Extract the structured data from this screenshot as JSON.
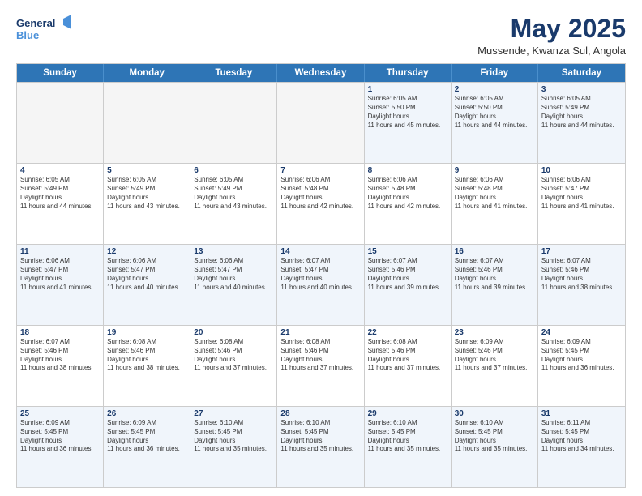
{
  "logo": {
    "line1": "General",
    "line2": "Blue"
  },
  "title": "May 2025",
  "location": "Mussende, Kwanza Sul, Angola",
  "days": [
    "Sunday",
    "Monday",
    "Tuesday",
    "Wednesday",
    "Thursday",
    "Friday",
    "Saturday"
  ],
  "rows": [
    [
      {
        "date": "",
        "sunrise": "",
        "sunset": "",
        "daylight": ""
      },
      {
        "date": "",
        "sunrise": "",
        "sunset": "",
        "daylight": ""
      },
      {
        "date": "",
        "sunrise": "",
        "sunset": "",
        "daylight": ""
      },
      {
        "date": "",
        "sunrise": "",
        "sunset": "",
        "daylight": ""
      },
      {
        "date": "1",
        "sunrise": "6:05 AM",
        "sunset": "5:50 PM",
        "daylight": "11 hours and 45 minutes."
      },
      {
        "date": "2",
        "sunrise": "6:05 AM",
        "sunset": "5:50 PM",
        "daylight": "11 hours and 44 minutes."
      },
      {
        "date": "3",
        "sunrise": "6:05 AM",
        "sunset": "5:49 PM",
        "daylight": "11 hours and 44 minutes."
      }
    ],
    [
      {
        "date": "4",
        "sunrise": "6:05 AM",
        "sunset": "5:49 PM",
        "daylight": "11 hours and 44 minutes."
      },
      {
        "date": "5",
        "sunrise": "6:05 AM",
        "sunset": "5:49 PM",
        "daylight": "11 hours and 43 minutes."
      },
      {
        "date": "6",
        "sunrise": "6:05 AM",
        "sunset": "5:49 PM",
        "daylight": "11 hours and 43 minutes."
      },
      {
        "date": "7",
        "sunrise": "6:06 AM",
        "sunset": "5:48 PM",
        "daylight": "11 hours and 42 minutes."
      },
      {
        "date": "8",
        "sunrise": "6:06 AM",
        "sunset": "5:48 PM",
        "daylight": "11 hours and 42 minutes."
      },
      {
        "date": "9",
        "sunrise": "6:06 AM",
        "sunset": "5:48 PM",
        "daylight": "11 hours and 41 minutes."
      },
      {
        "date": "10",
        "sunrise": "6:06 AM",
        "sunset": "5:47 PM",
        "daylight": "11 hours and 41 minutes."
      }
    ],
    [
      {
        "date": "11",
        "sunrise": "6:06 AM",
        "sunset": "5:47 PM",
        "daylight": "11 hours and 41 minutes."
      },
      {
        "date": "12",
        "sunrise": "6:06 AM",
        "sunset": "5:47 PM",
        "daylight": "11 hours and 40 minutes."
      },
      {
        "date": "13",
        "sunrise": "6:06 AM",
        "sunset": "5:47 PM",
        "daylight": "11 hours and 40 minutes."
      },
      {
        "date": "14",
        "sunrise": "6:07 AM",
        "sunset": "5:47 PM",
        "daylight": "11 hours and 40 minutes."
      },
      {
        "date": "15",
        "sunrise": "6:07 AM",
        "sunset": "5:46 PM",
        "daylight": "11 hours and 39 minutes."
      },
      {
        "date": "16",
        "sunrise": "6:07 AM",
        "sunset": "5:46 PM",
        "daylight": "11 hours and 39 minutes."
      },
      {
        "date": "17",
        "sunrise": "6:07 AM",
        "sunset": "5:46 PM",
        "daylight": "11 hours and 38 minutes."
      }
    ],
    [
      {
        "date": "18",
        "sunrise": "6:07 AM",
        "sunset": "5:46 PM",
        "daylight": "11 hours and 38 minutes."
      },
      {
        "date": "19",
        "sunrise": "6:08 AM",
        "sunset": "5:46 PM",
        "daylight": "11 hours and 38 minutes."
      },
      {
        "date": "20",
        "sunrise": "6:08 AM",
        "sunset": "5:46 PM",
        "daylight": "11 hours and 37 minutes."
      },
      {
        "date": "21",
        "sunrise": "6:08 AM",
        "sunset": "5:46 PM",
        "daylight": "11 hours and 37 minutes."
      },
      {
        "date": "22",
        "sunrise": "6:08 AM",
        "sunset": "5:46 PM",
        "daylight": "11 hours and 37 minutes."
      },
      {
        "date": "23",
        "sunrise": "6:09 AM",
        "sunset": "5:46 PM",
        "daylight": "11 hours and 37 minutes."
      },
      {
        "date": "24",
        "sunrise": "6:09 AM",
        "sunset": "5:45 PM",
        "daylight": "11 hours and 36 minutes."
      }
    ],
    [
      {
        "date": "25",
        "sunrise": "6:09 AM",
        "sunset": "5:45 PM",
        "daylight": "11 hours and 36 minutes."
      },
      {
        "date": "26",
        "sunrise": "6:09 AM",
        "sunset": "5:45 PM",
        "daylight": "11 hours and 36 minutes."
      },
      {
        "date": "27",
        "sunrise": "6:10 AM",
        "sunset": "5:45 PM",
        "daylight": "11 hours and 35 minutes."
      },
      {
        "date": "28",
        "sunrise": "6:10 AM",
        "sunset": "5:45 PM",
        "daylight": "11 hours and 35 minutes."
      },
      {
        "date": "29",
        "sunrise": "6:10 AM",
        "sunset": "5:45 PM",
        "daylight": "11 hours and 35 minutes."
      },
      {
        "date": "30",
        "sunrise": "6:10 AM",
        "sunset": "5:45 PM",
        "daylight": "11 hours and 35 minutes."
      },
      {
        "date": "31",
        "sunrise": "6:11 AM",
        "sunset": "5:45 PM",
        "daylight": "11 hours and 34 minutes."
      }
    ]
  ],
  "alt_rows": [
    0,
    2,
    4
  ]
}
